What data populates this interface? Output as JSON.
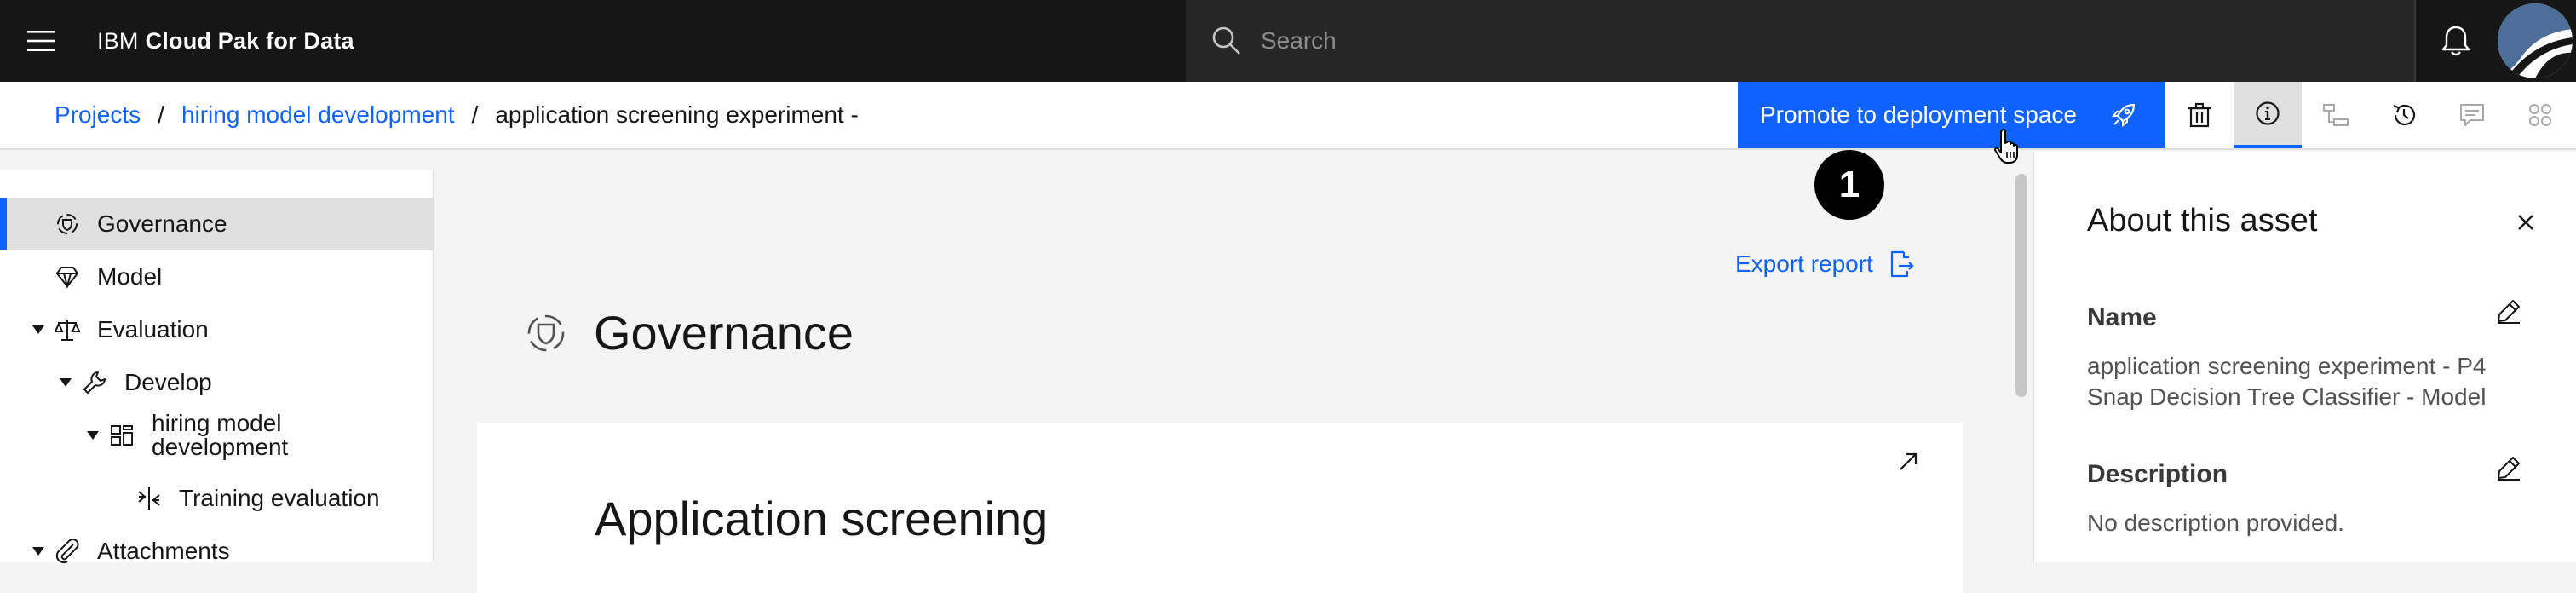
{
  "header": {
    "menu_icon": "hamburger-menu-icon",
    "brand_prefix": "IBM",
    "brand_name": "Cloud Pak for Data",
    "search_placeholder": "Search",
    "notification_icon": "bell-icon",
    "avatar_icon": "user-avatar"
  },
  "breadcrumb": {
    "items": [
      "Projects",
      "hiring model development",
      "application screening experiment -"
    ],
    "separator": "/"
  },
  "toolbar": {
    "promote_label": "Promote to deployment space",
    "promote_icon": "rocket-icon",
    "icons": [
      "trash-icon",
      "info-icon",
      "lineage-icon",
      "history-icon",
      "comment-icon",
      "apps-icon"
    ],
    "active_icon": "info-icon"
  },
  "sidenav": {
    "items": [
      {
        "label": "Governance",
        "icon": "governance-icon",
        "selected": true
      },
      {
        "label": "Model",
        "icon": "diamond-icon"
      },
      {
        "label": "Evaluation",
        "icon": "scales-icon",
        "expanded": true
      },
      {
        "label": "Develop",
        "icon": "wrench-icon",
        "expanded": true
      },
      {
        "label": "hiring model development",
        "line1": "hiring model",
        "line2": "development",
        "icon": "dashboard-icon",
        "expanded": true
      },
      {
        "label": "Training evaluation",
        "icon": "compare-icon"
      },
      {
        "label": "Attachments",
        "icon": "attachment-icon",
        "expanded": true
      }
    ]
  },
  "main": {
    "export_label": "Export report",
    "export_icon": "export-icon",
    "title": "Governance",
    "title_icon": "governance-icon",
    "card_title": "Application screening",
    "card_icon": "launch-icon",
    "step_badge": "1"
  },
  "panel": {
    "title": "About this asset",
    "name_label": "Name",
    "name_value": "application screening experiment - P4 Snap Decision Tree Classifier - Model",
    "description_label": "Description",
    "description_value": "No description provided."
  },
  "colors": {
    "topbar": "#161616",
    "search_bg": "#262626",
    "primary": "#0f62fe",
    "background": "#f4f4f4"
  }
}
